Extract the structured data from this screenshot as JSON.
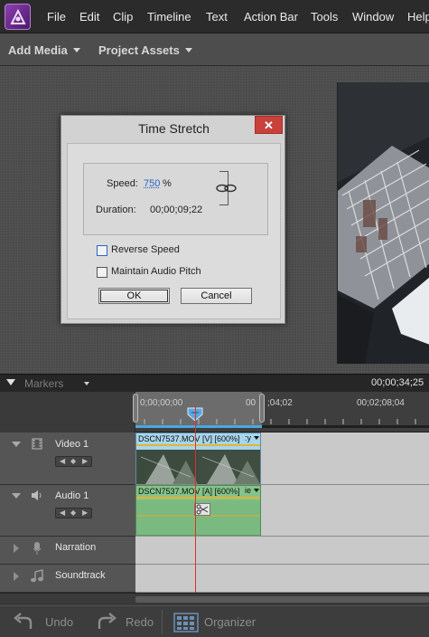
{
  "menubar": {
    "items": [
      "File",
      "Edit",
      "Clip",
      "Timeline",
      "Text",
      "Action Bar",
      "Tools",
      "Window",
      "Help"
    ]
  },
  "panelbar": {
    "add_media": "Add Media",
    "project_assets": "Project Assets"
  },
  "dialog": {
    "title": "Time Stretch",
    "close_glyph": "✕",
    "speed_label": "Speed:",
    "speed_value": "750",
    "speed_unit": "%",
    "duration_label": "Duration:",
    "duration_value": "00;00;09;22",
    "reverse_speed": "Reverse Speed",
    "maintain_audio_pitch": "Maintain Audio Pitch",
    "ok": "OK",
    "cancel": "Cancel",
    "reverse_checked": false,
    "pitch_checked": false
  },
  "timeline": {
    "markers_label": "Markers",
    "current_time": "00;00;34;25",
    "ruler_ticks": [
      "0;00;00;00",
      "00",
      ";04;02",
      "00;02;08;04"
    ],
    "tracks": [
      {
        "name": "Video 1",
        "clip_label": "DSCN7537.MOV [V] [600%]",
        "clip_suffix": ":y"
      },
      {
        "name": "Audio 1",
        "clip_label": "DSCN7537.MOV [A] [600%]",
        "clip_suffix": "ie"
      },
      {
        "name": "Narration"
      },
      {
        "name": "Soundtrack"
      }
    ]
  },
  "bottom": {
    "undo": "Undo",
    "redo": "Redo",
    "organizer": "Organizer"
  },
  "colors": {
    "accent_blue": "#4aa8df",
    "close_red": "#c9413b",
    "playhead_red": "#d9322d",
    "video_clip": "#a7d6ec",
    "audio_clip": "#84c38a"
  }
}
